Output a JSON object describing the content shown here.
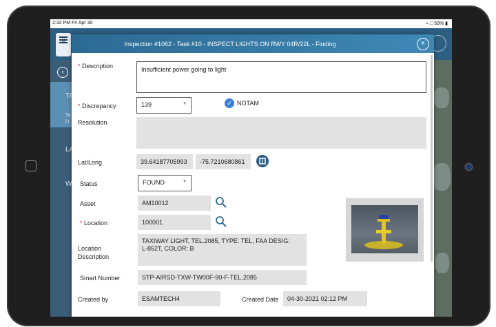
{
  "status_bar": {
    "time": "2:32 PM  Fri Apr 30",
    "battery": "59%"
  },
  "modal": {
    "title": "Inspection #1062 - Task #10 - INSPECT LIGHTS ON RWY 04R/22L - Finding"
  },
  "form": {
    "description": {
      "label": "Description",
      "value": "Insufficient power going to light"
    },
    "discrepancy": {
      "label": "Discrepancy",
      "value": "139"
    },
    "notam": {
      "label": "NOTAM",
      "checked": true
    },
    "resolution": {
      "label": "Resolution",
      "value": ""
    },
    "latlong": {
      "label": "Lat/Long",
      "lat": "39.64187705993",
      "long": "-75.7210680861"
    },
    "status": {
      "label": "Status",
      "value": "FOUND"
    },
    "asset": {
      "label": "Asset",
      "value": "AM10012"
    },
    "location": {
      "label": "Location",
      "value": "100001"
    },
    "location_description": {
      "label_line1": "Location",
      "label_line2": "Description",
      "value_line1": "TAXIWAY LIGHT, TEL.2085, TYPE: TEL, FAA DESIG:",
      "value_line2": "L-852T, COLOR: B"
    },
    "smart_number": {
      "label": "Smart Number",
      "value": "STP-AIRSD-TXW-TW00F-90-F-TEL.2085"
    },
    "created_by": {
      "label": "Created by",
      "value": "ESAMTECH4"
    },
    "created_date": {
      "label": "Created Date",
      "value": "04-30-2021 02:12 PM"
    }
  },
  "background": {
    "menu_label": "M",
    "left_letters": [
      "TA",
      "Ta",
      "Li",
      "LA",
      "W"
    ]
  },
  "colors": {
    "header": "#2c6a93",
    "required": "#d32f2f",
    "check": "#3b7fd6"
  }
}
